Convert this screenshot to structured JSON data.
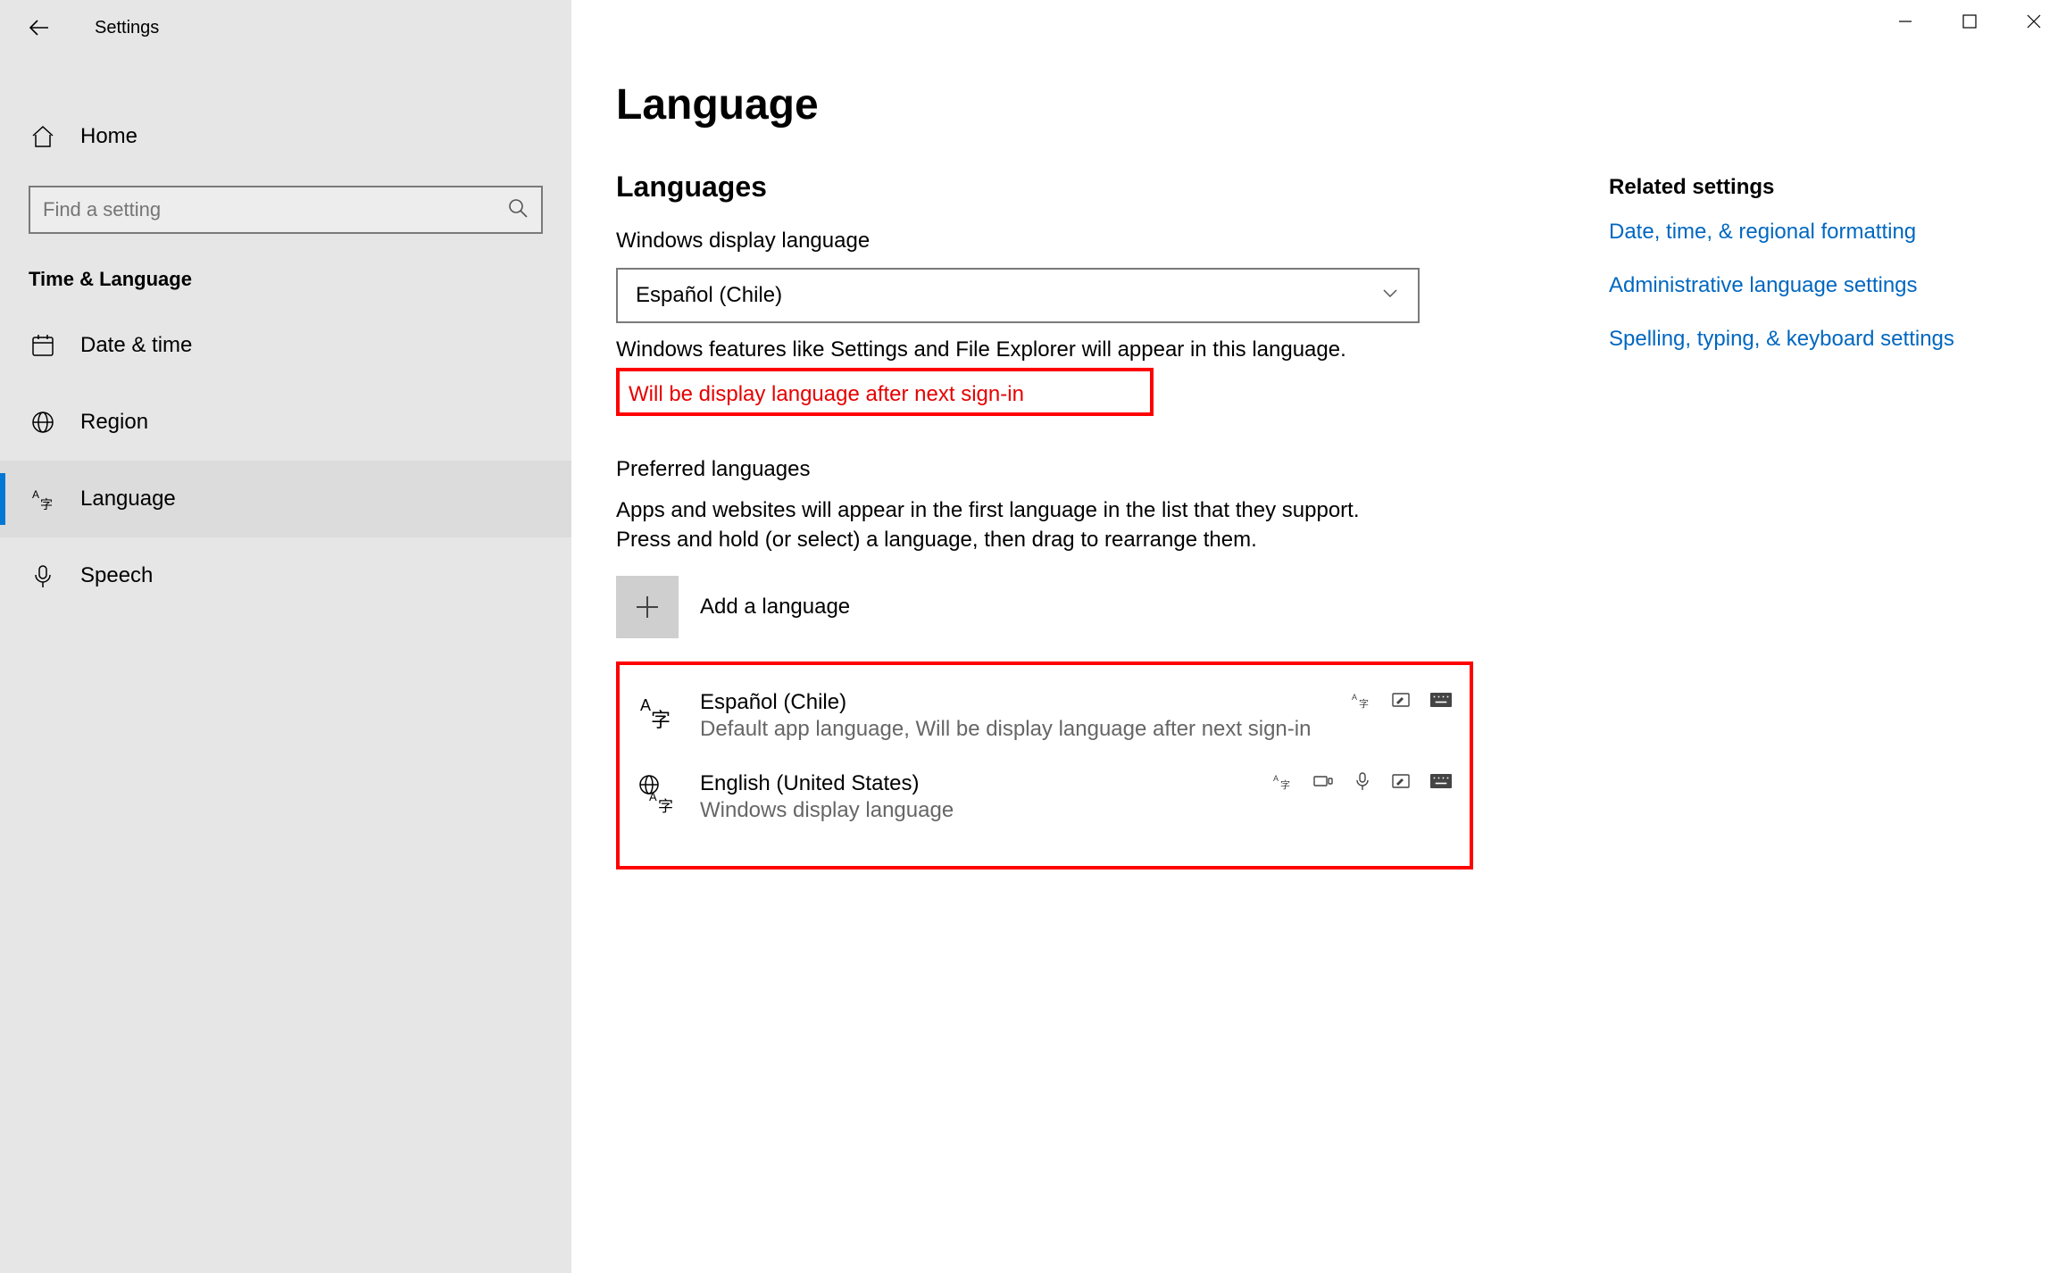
{
  "window": {
    "appTitle": "Settings"
  },
  "sidebar": {
    "home": "Home",
    "searchPlaceholder": "Find a setting",
    "category": "Time & Language",
    "items": [
      {
        "id": "date-time",
        "label": "Date & time",
        "active": false
      },
      {
        "id": "region",
        "label": "Region",
        "active": false
      },
      {
        "id": "language",
        "label": "Language",
        "active": true
      },
      {
        "id": "speech",
        "label": "Speech",
        "active": false
      }
    ]
  },
  "main": {
    "title": "Language",
    "languagesHeading": "Languages",
    "displayLangLabel": "Windows display language",
    "displayLangSelected": "Español (Chile)",
    "displayLangDesc": "Windows features like Settings and File Explorer will appear in this language.",
    "pendingNotice": "Will be display language after next sign-in",
    "preferredHeading": "Preferred languages",
    "preferredDesc": "Apps and websites will appear in the first language in the list that they support. Press and hold (or select) a language, then drag to rearrange them.",
    "addLanguage": "Add a language",
    "langList": [
      {
        "name": "Español (Chile)",
        "meta": "Default app language, Will be display language after next sign-in",
        "icon": "az",
        "features": [
          "display",
          "handwriting",
          "keyboard"
        ]
      },
      {
        "name": "English (United States)",
        "meta": "Windows display language",
        "icon": "globe-az",
        "features": [
          "display",
          "tts",
          "speech",
          "handwriting",
          "keyboard"
        ]
      }
    ]
  },
  "related": {
    "heading": "Related settings",
    "links": [
      "Date, time, & regional formatting",
      "Administrative language settings",
      "Spelling, typing, & keyboard settings"
    ]
  }
}
